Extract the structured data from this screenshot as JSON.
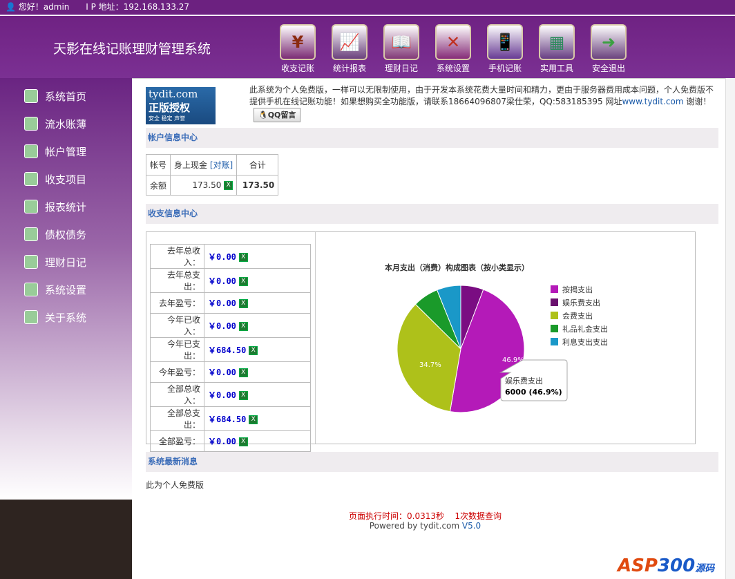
{
  "topbar": {
    "greeting": "您好！admin",
    "ip": "I P 地址：192.168.133.27"
  },
  "header": {
    "title": "天影在线记账理财管理系统",
    "nav": [
      {
        "label": "收支记账",
        "icon": "yen-icon",
        "glyph": "¥",
        "color": "#8b2a10"
      },
      {
        "label": "统计报表",
        "icon": "chart-icon",
        "glyph": "📈",
        "color": "#3a9a3a"
      },
      {
        "label": "理财日记",
        "icon": "book-icon",
        "glyph": "📖",
        "color": "#b07020"
      },
      {
        "label": "系统设置",
        "icon": "tools-icon",
        "glyph": "✕",
        "color": "#c03020"
      },
      {
        "label": "手机记账",
        "icon": "phone-icon",
        "glyph": "📱",
        "color": "#2a7ab0"
      },
      {
        "label": "实用工具",
        "icon": "calculator-icon",
        "glyph": "▦",
        "color": "#2a8a5a"
      },
      {
        "label": "安全退出",
        "icon": "exit-icon",
        "glyph": "➜",
        "color": "#3aa040"
      }
    ]
  },
  "sidebar": {
    "items": [
      "系统首页",
      "流水账薄",
      "帐户管理",
      "收支项目",
      "报表统计",
      "债权债务",
      "理财日记",
      "系统设置",
      "关于系统"
    ]
  },
  "notice": {
    "logo_title": "tydit.com",
    "logo_main": "正版授权",
    "logo_sub": "安全 稳定 声誉",
    "text": "此系统为个人免费版，一样可以无限制使用，由于开发本系统花费大量时间和精力，更由于服务器费用成本问题，个人免费版不提供手机在线记账功能！如果想购买全功能版，请联系18664096807梁仕荣，QQ:583185395 网址",
    "link": "www.tydit.com",
    "tail": " 谢谢！",
    "qq_button": "QQ留言"
  },
  "account": {
    "section": "帐户信息中心",
    "h_account": "帐号",
    "h_cash": "身上现金",
    "reconcile": "[对账]",
    "h_total": "合计",
    "row_label": "余额",
    "cash": "173.50",
    "total": "173.50"
  },
  "income": {
    "section": "收支信息中心",
    "rows": [
      {
        "label": "去年总收入：",
        "value": "￥0.00"
      },
      {
        "label": "去年总支出：",
        "value": "￥0.00"
      },
      {
        "label": "去年盈亏：",
        "value": "￥0.00"
      },
      {
        "label": "今年已收入：",
        "value": "￥0.00"
      },
      {
        "label": "今年已支出：",
        "value": "￥684.50"
      },
      {
        "label": "今年盈亏：",
        "value": "￥0.00"
      },
      {
        "label": "全部总收入：",
        "value": "￥0.00"
      },
      {
        "label": "全部总支出：",
        "value": "￥684.50"
      },
      {
        "label": "全部盈亏：",
        "value": "￥0.00"
      }
    ]
  },
  "chart_data": {
    "type": "pie",
    "title": "本月支出（消费）构成图表（按小类显示）",
    "slices": [
      {
        "name": "娱乐费支出",
        "value": 5.8,
        "color": "#7a0d82"
      },
      {
        "name": "按揭支出",
        "value": 46.9,
        "color": "#b41ab8"
      },
      {
        "name": "会费支出",
        "value": 34.7,
        "color": "#aec11a"
      },
      {
        "name": "礼品礼金支出",
        "value": 6.5,
        "color": "#1a9a2a"
      },
      {
        "name": "利息支出支出",
        "value": 6.1,
        "color": "#1a98c8"
      }
    ],
    "legend": [
      {
        "name": "按揭支出",
        "color": "#b41ab8"
      },
      {
        "name": "娱乐费支出",
        "color": "#6a126e"
      },
      {
        "name": "会费支出",
        "color": "#aec11a"
      },
      {
        "name": "礼品礼金支出",
        "color": "#1a9a2a"
      },
      {
        "name": "利息支出支出",
        "color": "#1a98c8"
      }
    ],
    "labels": [
      "46.9%",
      "34.7%"
    ],
    "tooltip_name": "娱乐费支出",
    "tooltip_value": "6000 (46.9%)",
    "legend_position": "right"
  },
  "news": {
    "section": "系统最新消息",
    "text": "此为个人免费版"
  },
  "footer": {
    "exec": "页面执行时间：0.0313秒",
    "queries": "1次数据查询",
    "powered": "Powered by tydit.com ",
    "version": "V5.0"
  },
  "watermark": "ASP300源码"
}
